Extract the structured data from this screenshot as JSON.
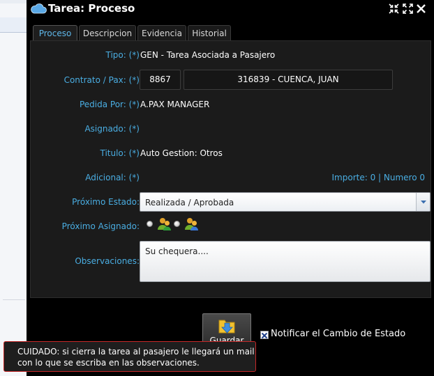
{
  "window": {
    "title": "Tarea: Proceso"
  },
  "tabs": [
    {
      "label": "Proceso"
    },
    {
      "label": "Descripcion"
    },
    {
      "label": "Evidencia"
    },
    {
      "label": "Historial"
    }
  ],
  "form": {
    "tipo_label": "Tipo: (*)",
    "tipo_value": "GEN - Tarea Asociada a Pasajero",
    "contrato_label": "Contrato / Pax: (*)",
    "contrato_value": "8867",
    "pax_value": "316839 - CUENCA, JUAN",
    "pedida_label": "Pedida Por: (*)",
    "pedida_value": "A.PAX MANAGER",
    "asignado_label": "Asignado: (*)",
    "asignado_value": "",
    "titulo_label": "Titulo: (*)",
    "titulo_value": "Auto Gestion: Otros",
    "adicional_label": "Adicional: (*)",
    "importe_text": "Importe: 0 | Numero 0",
    "proximo_estado_label": "Próximo Estado:",
    "proximo_estado_value": "Realizada / Aprobada",
    "proximo_asignado_label": "Próximo Asignado:",
    "observaciones_label": "Observaciones:",
    "observaciones_value": "Su chequera...."
  },
  "actions": {
    "save_label": "Guardar",
    "notify_label": "Notificar el Cambio de Estado",
    "notify_checked": true
  },
  "toast": {
    "line1": "CUIDADO: si cierra la tarea al pasajero le llegará un mail",
    "line2": "con lo que se escriba en las observaciones."
  },
  "colors": {
    "label": "#4aaee3",
    "toast_border": "#c62828",
    "panel_bg": "#1b1b1b"
  },
  "icons": {
    "title": "cloud-icon",
    "restore": "shrink-icon",
    "maximize": "expand-icon",
    "close": "close-icon",
    "save": "folder-save-icon",
    "assign": "user-group-icon"
  }
}
